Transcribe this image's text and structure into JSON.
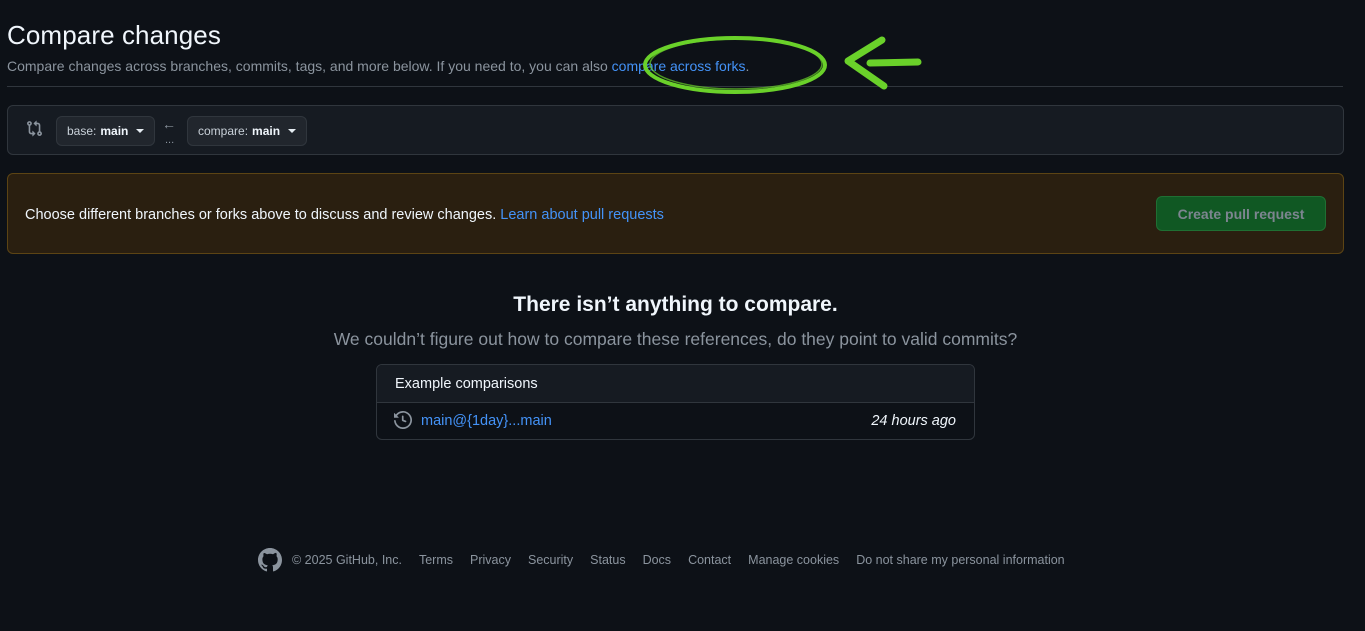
{
  "header": {
    "title": "Compare changes",
    "subtitle": "Compare changes across branches, commits, tags, and more below. If you need to, you can also ",
    "forks_link": "compare across forks",
    "forks_suffix": "."
  },
  "range": {
    "base_label": "base:",
    "base_branch": "main",
    "compare_label": "compare:",
    "compare_branch": "main",
    "arrow": "←",
    "dots": "..."
  },
  "flash": {
    "text": "Choose different branches or forks above to discuss and review changes. ",
    "link": "Learn about pull requests",
    "button": "Create pull request"
  },
  "blankslate": {
    "title": "There isn’t anything to compare.",
    "subtitle": "We couldn’t figure out how to compare these references, do they point to valid commits?"
  },
  "examples": {
    "header": "Example comparisons",
    "rows": [
      {
        "link": "main@{1day}...main",
        "time": "24 hours ago"
      }
    ]
  },
  "footer": {
    "copyright": "© 2025 GitHub, Inc.",
    "links": [
      "Terms",
      "Privacy",
      "Security",
      "Status",
      "Docs",
      "Contact",
      "Manage cookies",
      "Do not share my personal information"
    ]
  },
  "colors": {
    "background": "#0d1117",
    "link": "#4493f8",
    "annotation": "#6ad12a",
    "flash_bg": "#2a1f10",
    "button_green": "#105823"
  },
  "icons": {
    "compare": "git-compare-icon",
    "history": "history-icon",
    "logo": "github-logo-icon",
    "annotation": "green-arrow-annotation"
  }
}
